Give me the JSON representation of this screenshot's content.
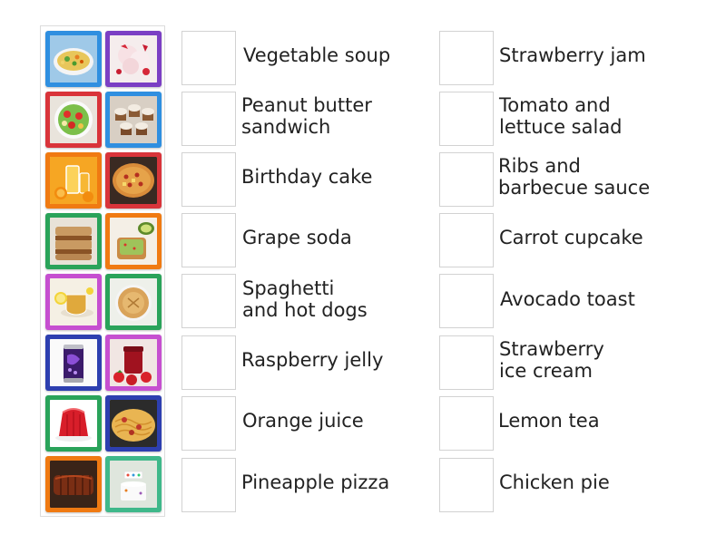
{
  "tiles": [
    {
      "frame": "#2f8fe0",
      "image": "vegetable-soup-photo"
    },
    {
      "frame": "#7b3fc4",
      "image": "strawberry-ice-cream-photo"
    },
    {
      "frame": "#d9343a",
      "image": "tomato-lettuce-salad-photo"
    },
    {
      "frame": "#2f8fe0",
      "image": "carrot-cupcakes-photo"
    },
    {
      "frame": "#f07a12",
      "image": "orange-juice-photo"
    },
    {
      "frame": "#d9343a",
      "image": "pineapple-pizza-photo"
    },
    {
      "frame": "#2aa35a",
      "image": "peanut-butter-sandwich-photo"
    },
    {
      "frame": "#f07a12",
      "image": "avocado-toast-photo"
    },
    {
      "frame": "#c64fd0",
      "image": "lemon-tea-photo"
    },
    {
      "frame": "#2aa35a",
      "image": "chicken-pie-photo"
    },
    {
      "frame": "#2d3fb0",
      "image": "grape-soda-can-photo"
    },
    {
      "frame": "#c64fd0",
      "image": "strawberry-jam-jar-photo"
    },
    {
      "frame": "#2aa35a",
      "image": "raspberry-jelly-photo"
    },
    {
      "frame": "#2d3fb0",
      "image": "spaghetti-hot-dogs-photo"
    },
    {
      "frame": "#f07a12",
      "image": "ribs-barbecue-photo"
    },
    {
      "frame": "#3fb88a",
      "image": "birthday-cake-photo"
    }
  ],
  "left_column": [
    "Vegetable soup",
    "Peanut butter\nsandwich",
    "Birthday cake",
    "Grape soda",
    "Spaghetti\nand hot dogs",
    "Raspberry jelly",
    "Orange juice",
    "Pineapple pizza"
  ],
  "right_column": [
    "Strawberry jam",
    "Tomato and\nlettuce salad",
    "Ribs and\nbarbecue sauce",
    "Carrot cupcake",
    "Avocado toast",
    "Strawberry\nice cream",
    "Lemon tea",
    "Chicken pie"
  ]
}
